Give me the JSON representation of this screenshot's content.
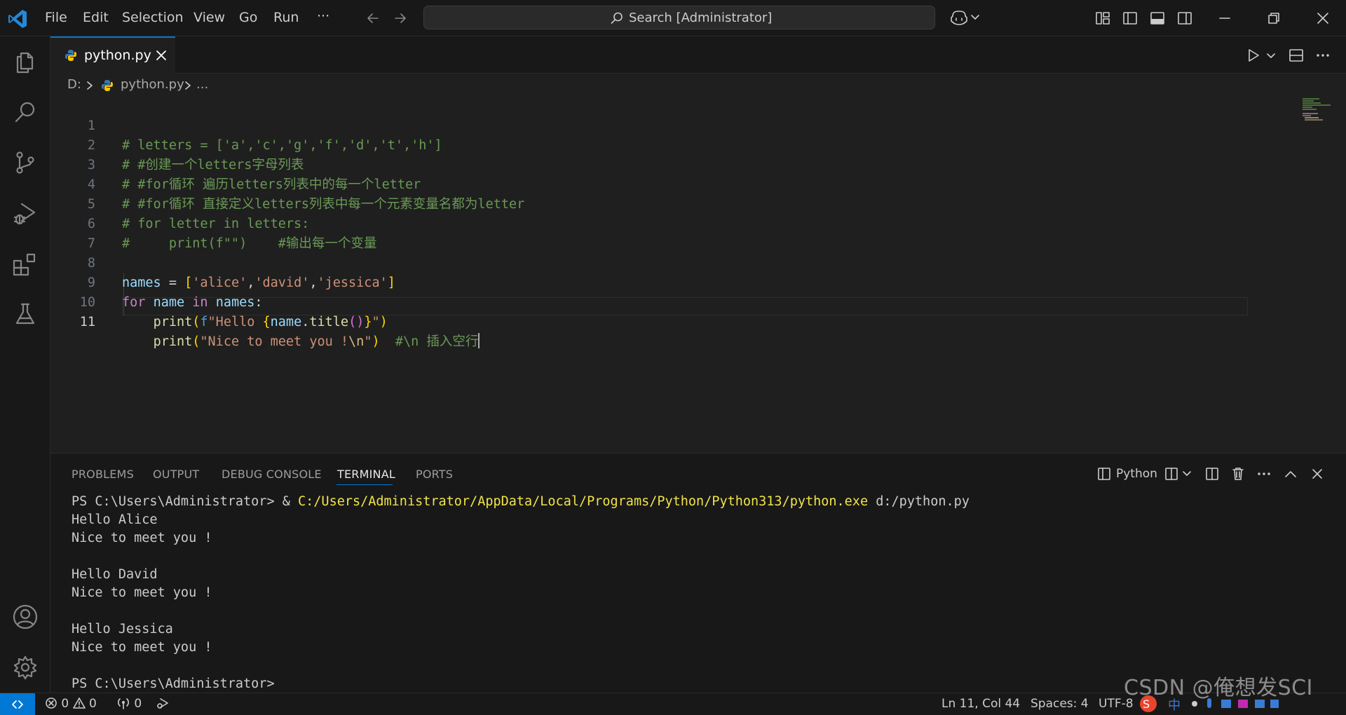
{
  "titlebar": {
    "menu": [
      "File",
      "Edit",
      "Selection",
      "View",
      "Go",
      "Run",
      "···"
    ],
    "search": "Search [Administrator]"
  },
  "tabs": [
    {
      "label": "python.py"
    }
  ],
  "breadcrumb": [
    "D:",
    "python.py",
    "..."
  ],
  "editor": {
    "line_numbers": [
      "1",
      "2",
      "3",
      "4",
      "5",
      "6",
      "7",
      "8",
      "9",
      "10",
      "11"
    ],
    "lines": [
      "# letters = ['a','c','g','f','d','t','h']",
      "# #创建一个letters字母列表",
      "# #for循环 遍历letters列表中的每一个letter",
      "# #for循环 直接定义letters列表中每一个元素变量名都为letter",
      "# for letter in letters:",
      "#     print(f\"\")    #输出每一个变量",
      "",
      "names = ['alice','david','jessica']",
      "for name in names:",
      "    print(f\"Hello {name.title()}\")",
      "    print(\"Nice to meet you !\\n\")  #\\n 插入空行"
    ],
    "active_line": 11
  },
  "panel": {
    "tabs": [
      "PROBLEMS",
      "OUTPUT",
      "DEBUG CONSOLE",
      "TERMINAL",
      "PORTS"
    ],
    "active_tab": "TERMINAL",
    "terminal_profile": "Python",
    "terminal": {
      "prompt": "PS C:\\Users\\Administrator> ",
      "command_op": "& ",
      "command_path": "C:/Users/Administrator/AppData/Local/Programs/Python/Python313/python.exe",
      "command_arg": " d:/python.py",
      "output": [
        "Hello Alice",
        "Nice to meet you !",
        "",
        "Hello David",
        "Nice to meet you !",
        "",
        "Hello Jessica",
        "Nice to meet you !",
        ""
      ],
      "final_prompt": "PS C:\\Users\\Administrator>"
    }
  },
  "statusbar": {
    "errors": "0",
    "warnings": "0",
    "ports": "0",
    "position": "Ln 11, Col 44",
    "spaces": "Spaces: 4",
    "encoding": "UTF-8"
  },
  "watermark": "CSDN @俺想发SCI",
  "colors": {
    "accent": "#0078d4",
    "background": "#1f1f1f",
    "chrome": "#181818",
    "comment": "#6a9955",
    "string": "#ce9178",
    "variable": "#9cdcfe",
    "keyword": "#c586c0",
    "function": "#dcdcaa",
    "terminal_path": "#f0e34a"
  }
}
